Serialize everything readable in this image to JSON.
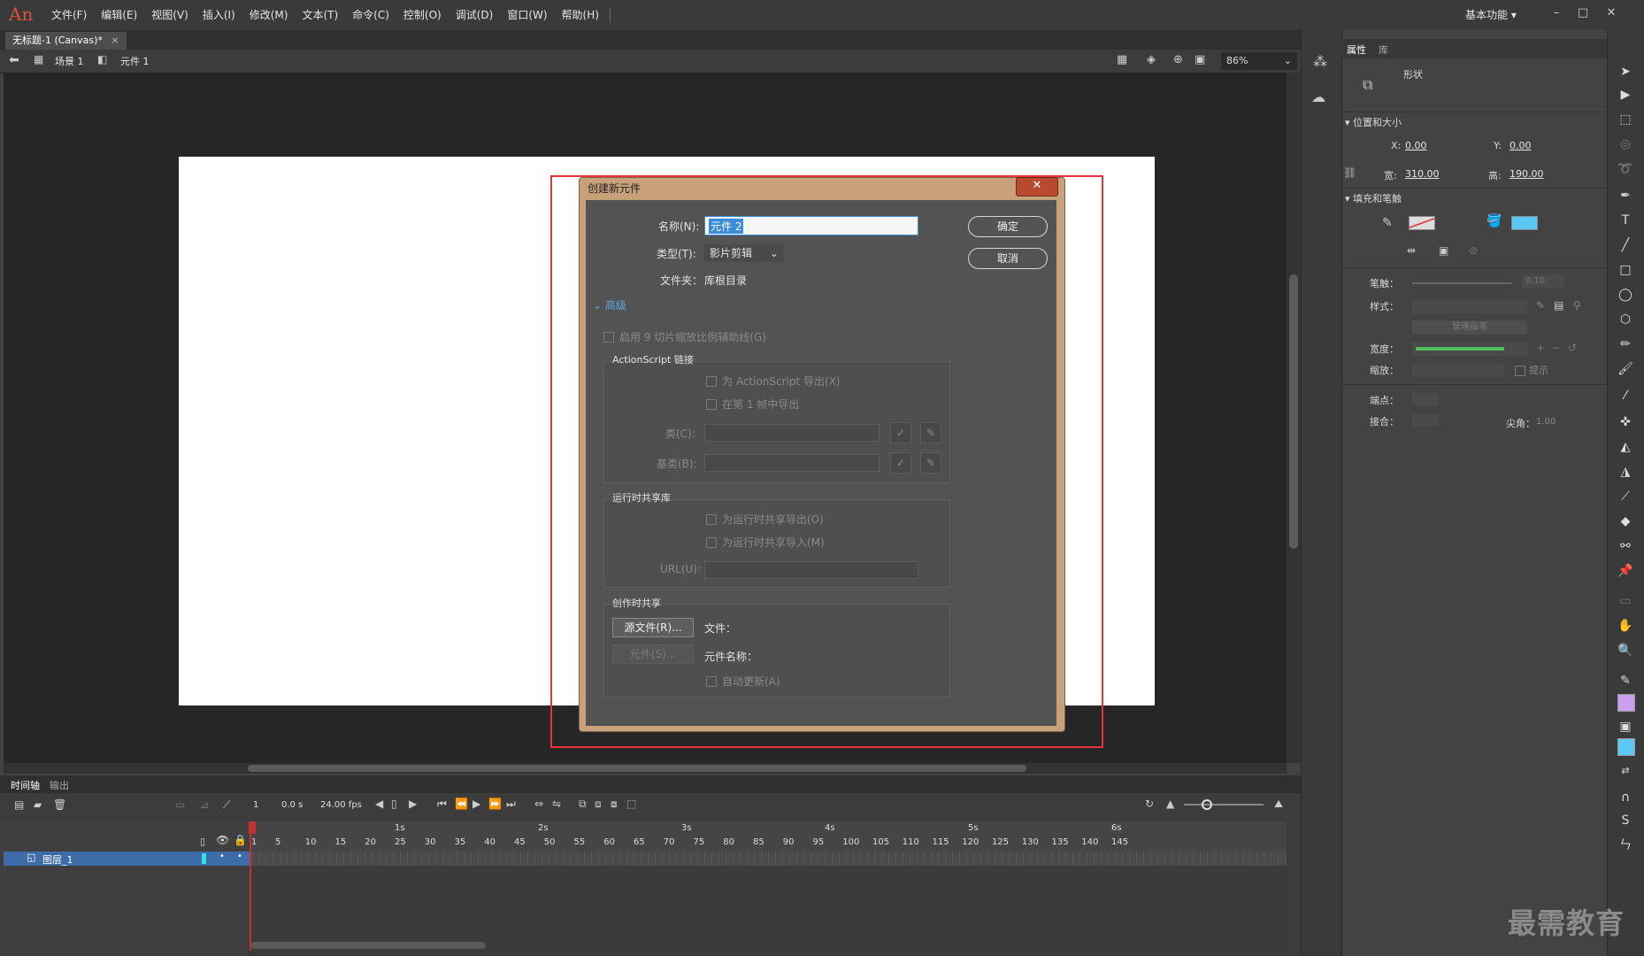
{
  "app": {
    "logo": "An",
    "workspace": "基本功能 ▾"
  },
  "menu": [
    "文件(F)",
    "编辑(E)",
    "视图(V)",
    "插入(I)",
    "修改(M)",
    "文本(T)",
    "命令(C)",
    "控制(O)",
    "调试(D)",
    "窗口(W)",
    "帮助(H)"
  ],
  "doc_tab": {
    "title": "无标题-1 (Canvas)*",
    "close": "×"
  },
  "breadcrumb": {
    "scene": "场景 1",
    "symbol": "元件 1"
  },
  "zoom": "86%",
  "dialog": {
    "title": "创建新元件",
    "close": "✕",
    "name_label": "名称(N):",
    "name_value": "元件 2",
    "type_label": "类型(T):",
    "type_value": "影片剪辑",
    "folder_label": "文件夹：",
    "folder_value": "库根目录",
    "advanced": "高级",
    "ok": "确定",
    "cancel": "取消",
    "enable_9slice": "启用 9 切片缩放比例辅助线(G)",
    "as_group": "ActionScript 链接",
    "export_as": "为 ActionScript 导出(X)",
    "export_frame1": "在第 1 帧中导出",
    "class_label": "类(C):",
    "baseclass_label": "基类(B):",
    "rsl_group": "运行时共享库",
    "rsl_export": "为运行时共享导出(O)",
    "rsl_import": "为运行时共享导入(M)",
    "url_label": "URL(U):",
    "authoring_group": "创作时共享",
    "source_file_btn": "源文件(R)...",
    "symbol_btn": "元件(S)...",
    "file_label": "文件：",
    "symbol_name_label": "元件名称：",
    "auto_update": "自动更新(A)"
  },
  "properties": {
    "tab_props": "属性",
    "tab_lib": "库",
    "shape": "形状",
    "pos_size": "位置和大小",
    "x_label": "X:",
    "x_value": "0.00",
    "y_label": "Y:",
    "y_value": "0.00",
    "w_label": "宽:",
    "w_value": "310.00",
    "h_label": "高:",
    "h_value": "190.00",
    "fill_stroke": "填充和笔触",
    "stroke_label": "笔触：",
    "stroke_value": "0.10",
    "style_label": "样式：",
    "manage_brush": "管理画笔",
    "width_label": "宽度：",
    "scale_label": "缩放：",
    "hint_label": "提示",
    "cap_label": "端点：",
    "join_label": "接合：",
    "miter_label": "尖角：",
    "miter_value": "1.00",
    "fill_color": "#5bc8f5"
  },
  "timeline": {
    "tab_timeline": "时间轴",
    "tab_output": "输出",
    "frame": "1",
    "time": "0.0 s",
    "fps": "24.00 fps",
    "layer_name": "图层_1",
    "seconds": [
      "1s",
      "2s",
      "3s",
      "4s",
      "5s",
      "6s"
    ],
    "ticks": [
      "1",
      "5",
      "10",
      "15",
      "20",
      "25",
      "30",
      "35",
      "40",
      "45",
      "50",
      "55",
      "60",
      "65",
      "70",
      "75",
      "80",
      "85",
      "90",
      "95",
      "100",
      "105",
      "110",
      "115",
      "120",
      "125",
      "130",
      "135",
      "140",
      "145"
    ]
  },
  "watermark": "最需教育"
}
